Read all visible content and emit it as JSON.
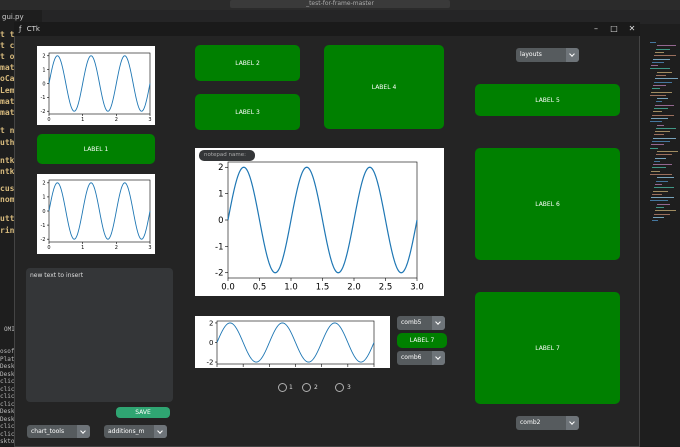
{
  "ide": {
    "tab_label": "gui.py",
    "search_placeholder": "_test-for-frame-master",
    "code_lines": [
      "t ti",
      "t c",
      "t os",
      "matp",
      "oCa",
      "Leme",
      "matp",
      "matp",
      "t nu",
      "uth",
      "ntki",
      "ntki",
      "cus",
      "nome",
      "utto",
      "rint"
    ],
    "panel_label": "OMI",
    "terminal_lines": [
      "osoft",
      "Platf",
      "Deskt",
      "Deskt",
      "click",
      "click",
      "click",
      "click",
      "Deskt",
      "Deskt",
      "click",
      "click",
      "sktop\\ mi"
    ]
  },
  "window": {
    "title": "CTk",
    "minimize": "–",
    "maximize": "□",
    "close": "✕"
  },
  "labels": {
    "label1": "LABEL 1",
    "label2": "LABEL 2",
    "label3": "LABEL 3",
    "label4": "LABEL 4",
    "label5": "LABEL 5",
    "label6": "LABEL 6",
    "label7_right": "LABEL 7",
    "label7_small": "LABEL 7"
  },
  "textbox": {
    "text": "new text to insert"
  },
  "save_button": "SAVE",
  "combos": {
    "chart_tools": "chart_tools",
    "additions": "additions_m",
    "layouts": "layouts",
    "comb5": "comb5",
    "comb6": "comb6",
    "comb2": "comb2"
  },
  "entry": {
    "placeholder": "notepad name:"
  },
  "radios": [
    "1",
    "2",
    "3"
  ],
  "chart_data": [
    {
      "type": "line",
      "name_in_ui": "small plot top",
      "x_ticks": [
        "0",
        "1",
        "2",
        "3"
      ],
      "y_ticks": [
        "2",
        "1",
        "0",
        "-1",
        "-2"
      ],
      "function": "2*sin(2*pi*x)",
      "xlim": [
        0,
        3
      ],
      "ylim": [
        -2.2,
        2.2
      ]
    },
    {
      "type": "line",
      "name_in_ui": "small plot bottom",
      "x_ticks": [
        "0",
        "1",
        "2",
        "3"
      ],
      "y_ticks": [
        "2",
        "1",
        "0",
        "-1",
        "-2"
      ],
      "function": "2*sin(2*pi*x)",
      "xlim": [
        0,
        3
      ],
      "ylim": [
        -2.2,
        2.2
      ]
    },
    {
      "type": "line",
      "name_in_ui": "main plot",
      "x_ticks": [
        "0.0",
        "0.5",
        "1.0",
        "1.5",
        "2.0",
        "2.5",
        "3.0"
      ],
      "y_ticks": [
        "2",
        "1",
        "0",
        "-1",
        "-2"
      ],
      "function": "2*sin(2*pi*x)",
      "xlim": [
        0,
        3
      ],
      "ylim": [
        -2.2,
        2.2
      ]
    },
    {
      "type": "line",
      "name_in_ui": "wide plot",
      "x_ticks": [],
      "y_ticks": [
        "2",
        "0",
        "-2"
      ],
      "function": "2*sin(2*pi*x)",
      "xlim": [
        0,
        3
      ],
      "ylim": [
        -2.2,
        2.2
      ]
    }
  ]
}
